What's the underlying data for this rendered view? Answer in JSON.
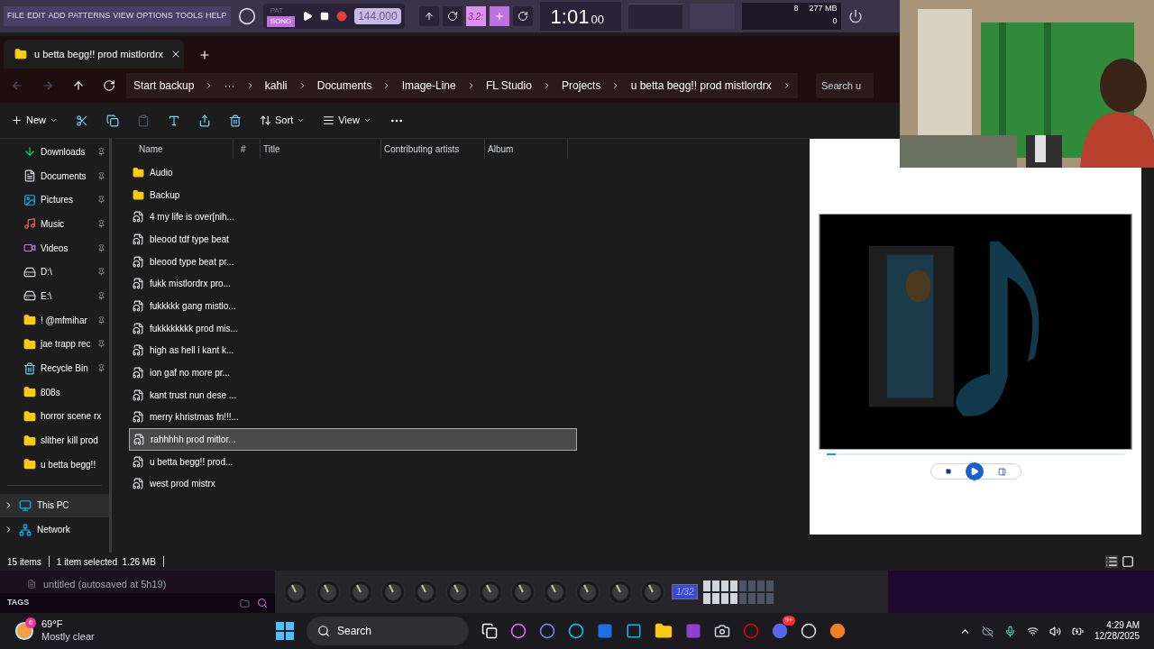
{
  "fl": {
    "menu": [
      "FILE",
      "EDIT",
      "ADD",
      "PATTERNS",
      "VIEW",
      "OPTIONS",
      "TOOLS",
      "HELP"
    ],
    "modes": [
      {
        "label": "PAT",
        "selected": false
      },
      {
        "label": "SONG",
        "selected": true
      }
    ],
    "tempo": "144.000",
    "snap": "3.2:",
    "time": "1:01",
    "time_small": "00",
    "cpu": "8",
    "memory": "277 MB",
    "voices": "0"
  },
  "explorer": {
    "tab": "u betta begg!! prod mistlordrx",
    "breadcrumbs": [
      "Start backup",
      "···",
      "kahli",
      "Documents",
      "Image-Line",
      "FL Studio",
      "Projects",
      "u betta begg!! prod mistlordrx"
    ],
    "search": {
      "placeholder": "Search u"
    },
    "toolbar": {
      "new": "New",
      "sort": "Sort",
      "view": "View"
    },
    "sidebar": [
      {
        "label": "Downloads",
        "kind": "downloads",
        "pinned": true
      },
      {
        "label": "Documents",
        "kind": "documents",
        "pinned": true
      },
      {
        "label": "Pictures",
        "kind": "pictures",
        "pinned": true
      },
      {
        "label": "Music",
        "kind": "music",
        "pinned": true
      },
      {
        "label": "Videos",
        "kind": "videos",
        "pinned": true
      },
      {
        "label": "D:\\",
        "kind": "drive",
        "pinned": true
      },
      {
        "label": "E:\\",
        "kind": "drive",
        "pinned": true
      },
      {
        "label": "!   @mfmihar",
        "kind": "folder",
        "pinned": true
      },
      {
        "label": "jae trapp rec",
        "kind": "folder",
        "pinned": true
      },
      {
        "label": "Recycle Bin",
        "kind": "bin",
        "pinned": true
      },
      {
        "label": "808s",
        "kind": "folder",
        "pinned": false
      },
      {
        "label": "horror scene rx",
        "kind": "folder",
        "pinned": false
      },
      {
        "label": "slither kill prod",
        "kind": "folder",
        "pinned": false
      },
      {
        "label": "u betta begg!!",
        "kind": "folder",
        "pinned": false
      }
    ],
    "tree": [
      {
        "label": "This PC",
        "kind": "pc",
        "selected": true
      },
      {
        "label": "Network",
        "kind": "network",
        "selected": false
      }
    ],
    "columns": [
      "Name",
      "#",
      "Title",
      "Contributing artists",
      "Album"
    ],
    "files": [
      {
        "name": "Audio",
        "kind": "folder",
        "selected": false
      },
      {
        "name": "Backup",
        "kind": "folder",
        "selected": false
      },
      {
        "name": "4 my life is over[nih...",
        "kind": "audio",
        "selected": false
      },
      {
        "name": "bleood tdf type beat",
        "kind": "audio",
        "selected": false
      },
      {
        "name": "bleood type beat pr...",
        "kind": "audio",
        "selected": false
      },
      {
        "name": "fukk mistlordrx pro...",
        "kind": "audio",
        "selected": false
      },
      {
        "name": "fukkkkk gang mistlo...",
        "kind": "audio",
        "selected": false
      },
      {
        "name": "fukkkkkkkk prod mis...",
        "kind": "audio",
        "selected": false
      },
      {
        "name": "high as hell i kant k...",
        "kind": "audio",
        "selected": false
      },
      {
        "name": "ion gaf no more pr...",
        "kind": "audio",
        "selected": false
      },
      {
        "name": "kant trust nun dese ...",
        "kind": "audio",
        "selected": false
      },
      {
        "name": "merry khristmas fn!!!...",
        "kind": "audio",
        "selected": false
      },
      {
        "name": "rahhhhh prod mitlor...",
        "kind": "audio",
        "selected": true
      },
      {
        "name": "u betta begg!! prod...",
        "kind": "audio",
        "selected": false
      },
      {
        "name": "west prod mistrx",
        "kind": "audio",
        "selected": false
      }
    ],
    "status": [
      "15 items",
      "1 item selected  1.26 MB"
    ],
    "preview": {
      "level": 0.03
    }
  },
  "fl_bottom": {
    "browser_item": "untitled (autosaved at 5h19)",
    "tags": "TAGS",
    "swing": "1/32"
  },
  "taskbar": {
    "temperature": "69°F",
    "weather": "Mostly clear",
    "weather_badge": "6",
    "search": "Search",
    "discord_badge": "9+",
    "time": "4:29 AM",
    "date": "12/28/2025"
  }
}
